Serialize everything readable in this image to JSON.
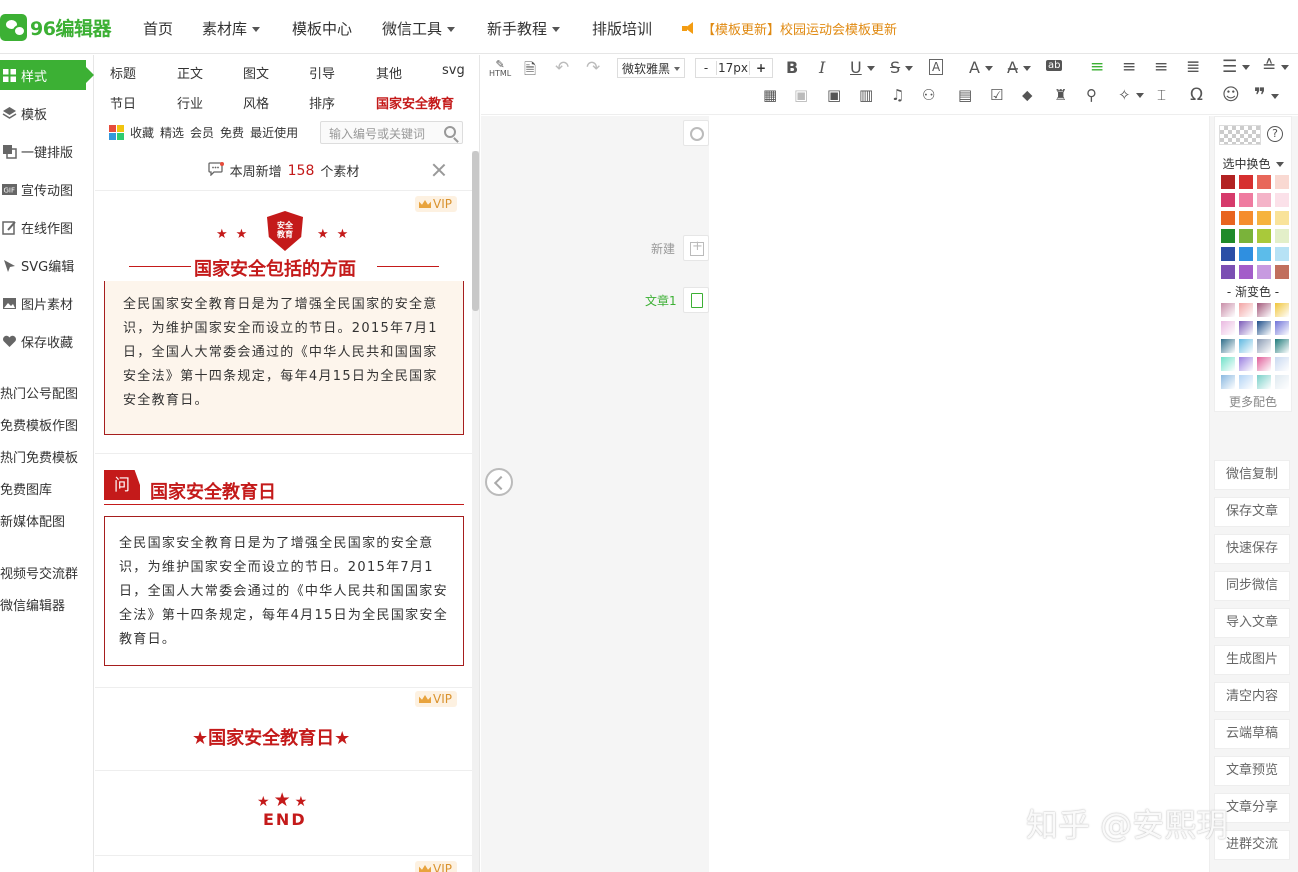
{
  "app": {
    "name": "96编辑器"
  },
  "nav": {
    "items": [
      "首页",
      "素材库",
      "模板中心",
      "微信工具",
      "新手教程",
      "排版培训"
    ],
    "notice": "【模板更新】校园运动会模板更新"
  },
  "sidebar": {
    "items": [
      "样式",
      "模板",
      "一键排版",
      "宣传动图",
      "在线作图",
      "SVG编辑",
      "图片素材",
      "保存收藏"
    ],
    "links": [
      "热门公号配图",
      "免费模板作图",
      "热门免费模板",
      "免费图库",
      "新媒体配图",
      "视频号交流群",
      "微信编辑器"
    ]
  },
  "categories": {
    "row1": [
      "标题",
      "正文",
      "图文",
      "引导",
      "其他",
      "svg"
    ],
    "row2": [
      "节日",
      "行业",
      "风格",
      "排序",
      "国家安全教育"
    ],
    "filters": [
      "收藏",
      "精选",
      "会员",
      "免费",
      "最近使用"
    ],
    "search_placeholder": "输入编号或关键词"
  },
  "weekly": {
    "prefix": "本周新增",
    "count": "158",
    "suffix": "个素材"
  },
  "cards": {
    "vip": "VIP",
    "badge_text": "安全\n教育",
    "card1_title": "国家安全包括的方面",
    "card1_text": "全民国家安全教育日是为了增强全民国家的安全意识，为维护国家安全而设立的节日。2015年7月1日，全国人大常委会通过的《中华人民共和国国家安全法》第十四条规定，每年4月15日为全民国家安全教育日。",
    "card2_tag": "问",
    "card2_title": "国家安全教育日",
    "card2_text": "全民国家安全教育日是为了增强全民国家的安全意识，为维护国家安全而设立的节日。2015年7月1日，全国人大常委会通过的《中华人民共和国国家安全法》第十四条规定，每年4月15日为全民国家安全教育日。",
    "card3_title": "★国家安全教育日★",
    "card4_text": "END"
  },
  "toolbar": {
    "font": "微软雅黑",
    "font_size": "17px",
    "html_label": "HTML"
  },
  "editor": {
    "new_label": "新建",
    "article_label": "文章1",
    "watermark": "知乎 @安熙玥"
  },
  "colors": {
    "select_label": "选中换色",
    "gradient_label": "- 渐变色 -",
    "more_label": "更多配色",
    "solid": [
      "#b22222",
      "#d62f2f",
      "#e8675a",
      "#f9d9d2",
      "#d63a6b",
      "#ef7ba0",
      "#f4b3c8",
      "#fbe1e9",
      "#e8641f",
      "#f58d2d",
      "#f6b33e",
      "#f9e39a",
      "#1f8a2a",
      "#7ab33a",
      "#a9c93a",
      "#e3efc9",
      "#2b4ea6",
      "#2f8fe0",
      "#5cbcea",
      "#b7e2f5",
      "#7b4fb3",
      "#a35dc9",
      "#c79ae0",
      "#c16f5d"
    ],
    "gradient": [
      "#c98ea8",
      "#f2a3a3",
      "#a3587a",
      "#f0c53a",
      "#e9b8e0",
      "#7b5bb8",
      "#1f4f8a",
      "#6f73d8",
      "#2f6e8a",
      "#5fb8e0",
      "#8a9bb3",
      "#1f7a7a",
      "#6fe0c9",
      "#9a7fe0",
      "#e05f9a",
      "#c9d9f0",
      "#8ab8e0",
      "#b3d4f5",
      "#7ad0c9",
      "#dfe9f0"
    ]
  },
  "right_buttons": [
    "微信复制",
    "保存文章",
    "快速保存",
    "同步微信",
    "导入文章",
    "生成图片",
    "清空内容",
    "云端草稿",
    "文章预览",
    "文章分享",
    "进群交流"
  ]
}
